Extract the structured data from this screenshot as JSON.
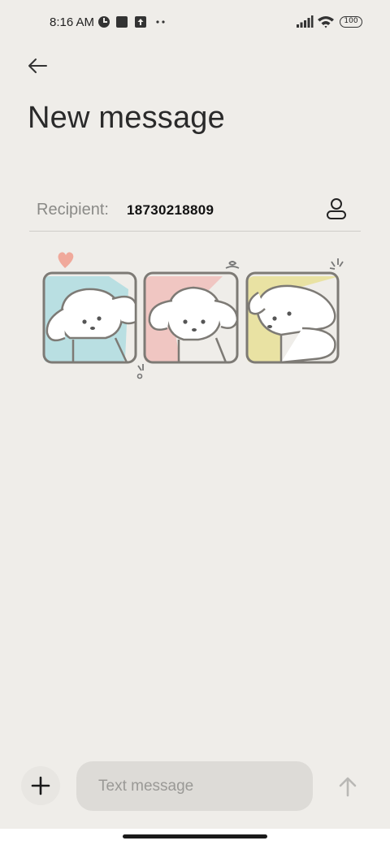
{
  "status_bar": {
    "time": "8:16 AM",
    "battery_level": "100",
    "icons": [
      "app-notification-icon",
      "square-notification-icon",
      "upload-notification-icon",
      "more-dots-icon",
      "signal-icon",
      "wifi-icon",
      "battery-icon"
    ]
  },
  "header": {
    "title": "New message",
    "back_icon": "back-arrow-icon"
  },
  "recipient": {
    "label": "Recipient:",
    "value": "18730218809",
    "contact_icon": "contact-person-icon"
  },
  "sticker": {
    "description_icon": "three-puppies-sticker",
    "panel_colors": [
      "#b9dfe2",
      "#f0c6c2",
      "#e9e2a3"
    ]
  },
  "composer": {
    "placeholder": "Text message",
    "value": "",
    "attach_icon": "plus-icon",
    "send_icon": "send-arrow-icon"
  },
  "colors": {
    "background": "#efede9",
    "input_bg": "#dddbd7",
    "accent_heart": "#f0a99b"
  }
}
